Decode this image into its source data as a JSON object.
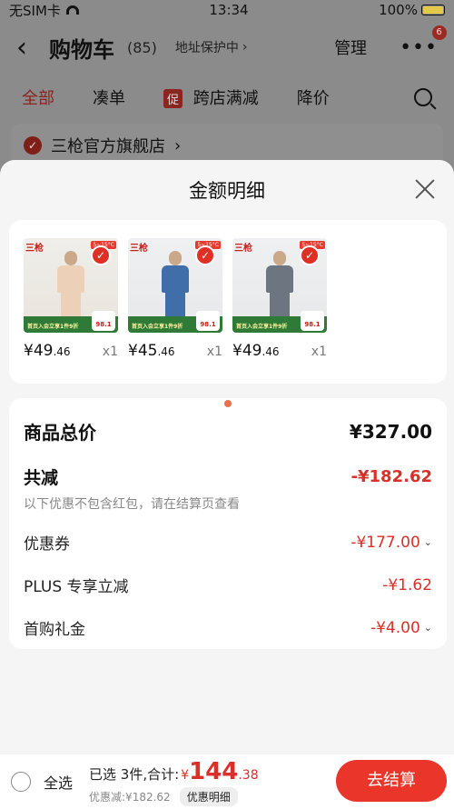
{
  "status_bar": {
    "carrier": "无SIM卡",
    "time": "13:34",
    "battery": "100%"
  },
  "cart_header": {
    "back_icon": "‹",
    "title": "购物车",
    "count": "(85)",
    "address_protect": "地址保护中",
    "manage": "管理",
    "badge": "6"
  },
  "cart_tabs": {
    "all": "全部",
    "combine": "凑单",
    "tag": "促",
    "cross_store": "跨店满减",
    "price_drop": "降价"
  },
  "store": {
    "name": "三枪官方旗舰店",
    "arrow": "›"
  },
  "sheet": {
    "title": "金额明细"
  },
  "products": [
    {
      "brand": "三枪",
      "temp": "5~15°C",
      "promo": "首页入会立享1件9折",
      "price_big": "¥49",
      "price_small": ".46",
      "qty": "x1",
      "badge": "98.1",
      "style": "skin"
    },
    {
      "brand": "三枪",
      "temp": "5~15°C",
      "promo": "首页入会立享1件9折",
      "price_big": "¥45",
      "price_small": ".46",
      "qty": "x1",
      "badge": "98.1",
      "style": "blue"
    },
    {
      "brand": "三枪",
      "temp": "5~15°C",
      "promo": "首页入会立享1件9折",
      "price_big": "¥49",
      "price_small": ".46",
      "qty": "x1",
      "badge": "98.1",
      "style": "grey"
    }
  ],
  "details": {
    "total_label": "商品总价",
    "total_value": "¥327.00",
    "discount_label": "共减",
    "discount_value": "-¥182.62",
    "note": "以下优惠不包含红包，请在结算页查看",
    "coupon_label": "优惠券",
    "coupon_value": "-¥177.00",
    "plus_label": "PLUS 专享立减",
    "plus_value": "-¥1.62",
    "gift_label": "首购礼金",
    "gift_value": "-¥4.00"
  },
  "bottom_bar": {
    "select_all": "全选",
    "selected_text": "已选 3件,合计:",
    "currency": "¥",
    "amount_int": "144",
    "amount_dec": ".38",
    "saved_text": "优惠减:¥182.62",
    "detail_button": "优惠明细",
    "checkout": "去结算"
  },
  "colors": {
    "accent": "#e9352a",
    "price_red": "#d9302a"
  }
}
